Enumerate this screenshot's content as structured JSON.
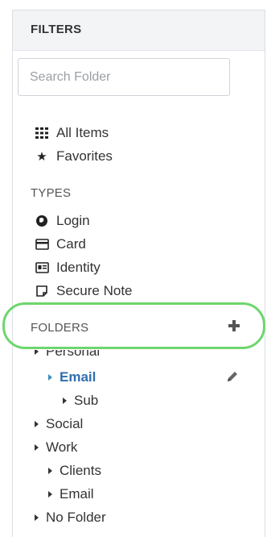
{
  "filters": {
    "title": "FILTERS",
    "search_placeholder": "Search Folder"
  },
  "nav": {
    "all_items": "All Items",
    "favorites": "Favorites"
  },
  "types": {
    "label": "TYPES",
    "login": "Login",
    "card": "Card",
    "identity": "Identity",
    "secure_note": "Secure Note"
  },
  "folders": {
    "label": "FOLDERS",
    "personal": "Personal",
    "email": "Email",
    "sub": "Sub",
    "social": "Social",
    "work": "Work",
    "clients": "Clients",
    "work_email": "Email",
    "no_folder": "No Folder"
  },
  "colors": {
    "highlight": "#6dd66d",
    "active_blue": "#2f6fad"
  }
}
